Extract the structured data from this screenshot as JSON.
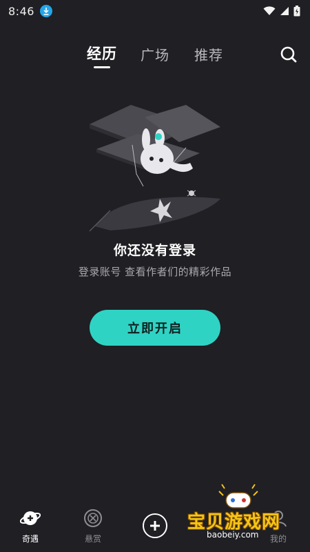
{
  "status_bar": {
    "time": "8:46"
  },
  "tabs": [
    {
      "label": "经历",
      "active": true
    },
    {
      "label": "广场",
      "active": false
    },
    {
      "label": "推荐",
      "active": false
    }
  ],
  "empty_state": {
    "title": "你还没有登录",
    "subtitle": "登录账号 查看作者们的精彩作品",
    "button_label": "立即开启"
  },
  "bottom_nav": {
    "items": [
      {
        "label": "奇遇",
        "icon": "planet-icon",
        "active": true
      },
      {
        "label": "悬赏",
        "icon": "bounty-icon",
        "active": false
      },
      {
        "label": "",
        "icon": "add-icon",
        "active": false
      },
      {
        "label": "",
        "icon": "",
        "active": false
      },
      {
        "label": "我的",
        "icon": "profile-icon",
        "active": false
      }
    ]
  },
  "watermark": {
    "text": "宝贝游戏网",
    "url": "baobeiy.com"
  },
  "colors": {
    "background": "#1f1f24",
    "accent": "#2fd3c4",
    "download_badge": "#23a6e8"
  }
}
